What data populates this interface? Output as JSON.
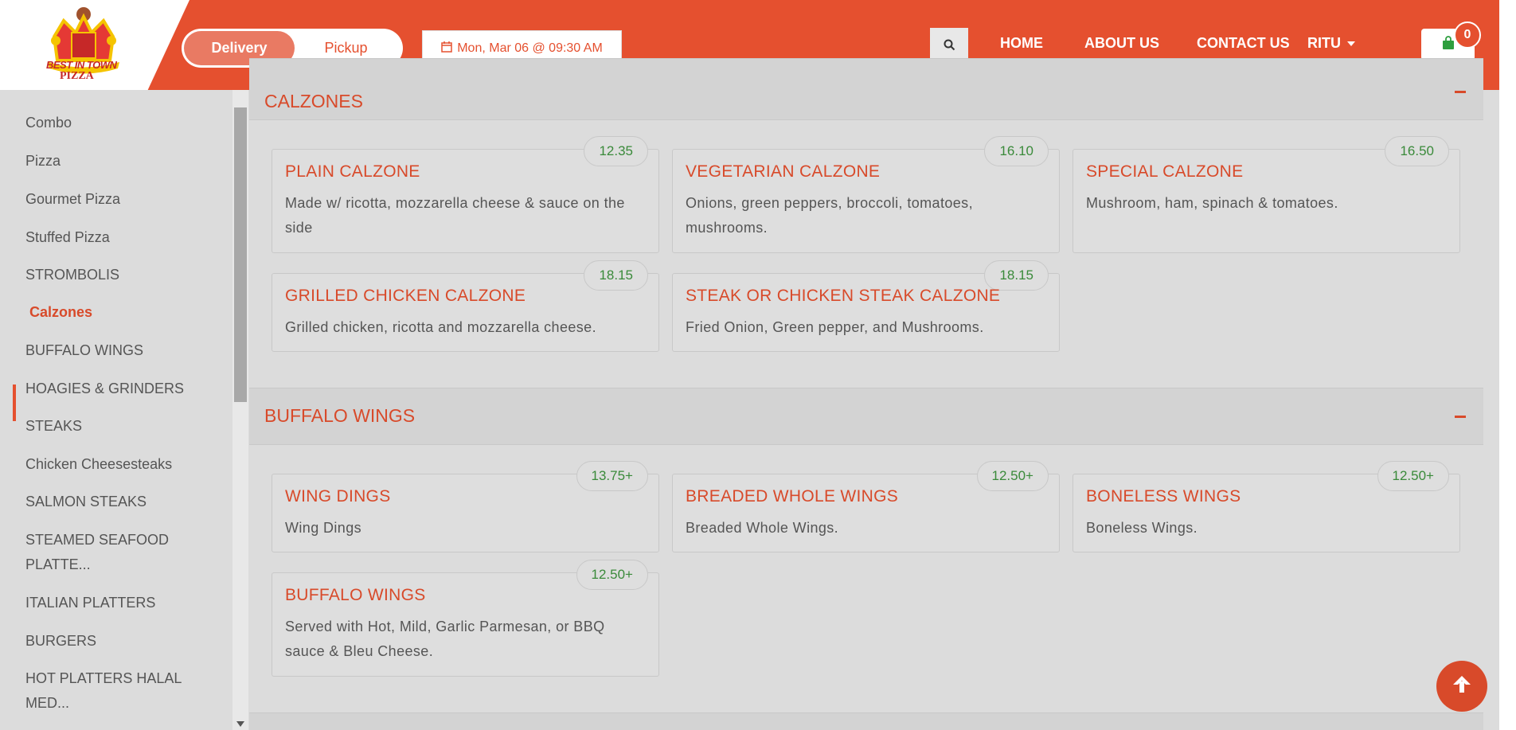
{
  "brand": {
    "logo_line1": "BEST IN TOWN",
    "logo_line2": "PIZZA",
    "primary_color": "#e5502f"
  },
  "header": {
    "delivery_label": "Delivery",
    "pickup_label": "Pickup",
    "datetime": "Mon, Mar 06 @ 09:30 AM",
    "nav": {
      "home": "HOME",
      "about": "ABOUT US",
      "contact": "CONTACT US",
      "user": "RITU"
    },
    "cart_count": "0"
  },
  "sidebar": {
    "items": [
      {
        "label": "Combo"
      },
      {
        "label": "Pizza"
      },
      {
        "label": "Gourmet Pizza"
      },
      {
        "label": "Stuffed Pizza"
      },
      {
        "label": "STROMBOLIS"
      },
      {
        "label": "Calzones"
      },
      {
        "label": "BUFFALO WINGS"
      },
      {
        "label": "HOAGIES & GRINDERS"
      },
      {
        "label": "STEAKS"
      },
      {
        "label": "Chicken Cheesesteaks"
      },
      {
        "label": "SALMON STEAKS"
      },
      {
        "label": "STEAMED SEAFOOD PLATTE..."
      },
      {
        "label": "ITALIAN PLATTERS"
      },
      {
        "label": "BURGERS"
      },
      {
        "label": "HOT PLATTERS HALAL MED..."
      }
    ]
  },
  "sections": [
    {
      "title": "CALZONES",
      "items": [
        {
          "name": "PLAIN CALZONE",
          "price": "12.35",
          "desc": "Made w/ ricotta, mozzarella cheese & sauce on the side"
        },
        {
          "name": "VEGETARIAN CALZONE",
          "price": "16.10",
          "desc": "Onions, green peppers, broccoli, tomatoes, mushrooms."
        },
        {
          "name": "SPECIAL CALZONE",
          "price": "16.50",
          "desc": "Mushroom, ham, spinach & tomatoes."
        },
        {
          "name": "GRILLED CHICKEN CALZONE",
          "price": "18.15",
          "desc": "Grilled chicken, ricotta and mozzarella cheese."
        },
        {
          "name": "STEAK OR CHICKEN STEAK CALZONE",
          "price": "18.15",
          "desc": "Fried Onion, Green pepper, and Mushrooms."
        }
      ]
    },
    {
      "title": "BUFFALO WINGS",
      "items": [
        {
          "name": "WING DINGS",
          "price": "13.75+",
          "desc": "Wing Dings"
        },
        {
          "name": "BREADED WHOLE WINGS",
          "price": "12.50+",
          "desc": "Breaded Whole Wings."
        },
        {
          "name": "BONELESS WINGS",
          "price": "12.50+",
          "desc": "Boneless Wings."
        },
        {
          "name": "BUFFALO WINGS",
          "price": "12.50+",
          "desc": "Served with Hot, Mild, Garlic Parmesan, or BBQ sauce & Bleu Cheese."
        }
      ]
    }
  ]
}
